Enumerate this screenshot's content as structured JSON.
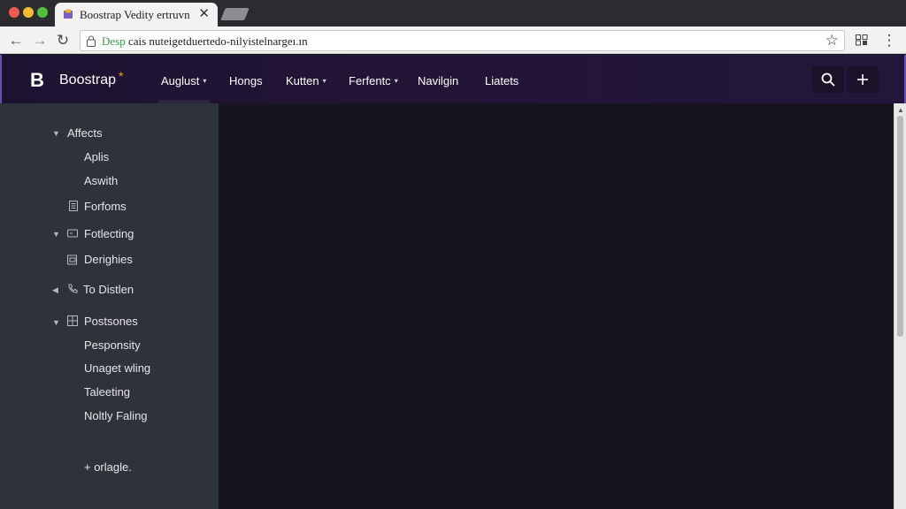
{
  "browser": {
    "tab_title": "Boostrap Vedity ertruvn",
    "url_secure_part": "Desp",
    "url_rest": "cais nuteigetduertedo-nilyistelnargeı.ın",
    "nav": {
      "back": "←",
      "forward": "→",
      "reload": "↻",
      "star": "☆",
      "close": "✕",
      "menu": "⋮"
    }
  },
  "navbar": {
    "brand_mark": "B",
    "brand_name": "Boostrap",
    "brand_star": "*",
    "items": [
      {
        "label": "Auglust",
        "has_caret": true
      },
      {
        "label": "Hongs",
        "has_caret": false
      },
      {
        "label": "Kutten",
        "has_caret": true
      },
      {
        "label": "Ferfentc",
        "has_caret": true
      },
      {
        "label": "Navilgin",
        "has_caret": false
      },
      {
        "label": "Liatets",
        "has_caret": false
      }
    ],
    "search_icon": "search-icon",
    "add_icon": "plus-icon",
    "caret": "▾"
  },
  "sidebar": {
    "items": [
      {
        "label": "Affects",
        "kind": "group-open"
      },
      {
        "label": "Aplis",
        "kind": "child"
      },
      {
        "label": "Aswith",
        "kind": "child"
      },
      {
        "label": "Forfoms",
        "kind": "doc"
      },
      {
        "label": "Fotlecting",
        "kind": "group-open-box"
      },
      {
        "label": "Derighies",
        "kind": "image"
      },
      {
        "label": "To Distlen",
        "kind": "group-closed-phone"
      },
      {
        "label": "Postsones",
        "kind": "group-open-grid"
      },
      {
        "label": "Pesponsity",
        "kind": "child"
      },
      {
        "label": "Unaget wling",
        "kind": "child"
      },
      {
        "label": "Taleeting",
        "kind": "child"
      },
      {
        "label": "Noltly Faling",
        "kind": "child"
      },
      {
        "label": "+ orlagle.",
        "kind": "action"
      }
    ]
  },
  "colors": {
    "navbar_bg": "#231536",
    "sidebar_bg": "#2e323a",
    "main_bg": "#16151f",
    "accent_star": "#f0a030"
  }
}
